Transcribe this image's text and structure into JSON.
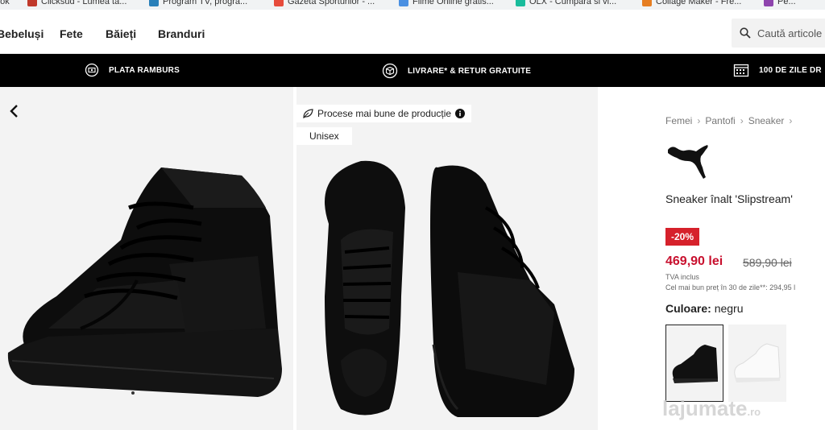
{
  "bookmarks": [
    {
      "label": "ook",
      "color": "#3b5998"
    },
    {
      "label": "Clicksud - Lumea ta...",
      "color": "#c0392b"
    },
    {
      "label": "Program TV, progra...",
      "color": "#2980b9"
    },
    {
      "label": "Gazeta Sporturilor - ...",
      "color": "#e74c3c"
    },
    {
      "label": "Filme Online gratis...",
      "color": "#4a90e2"
    },
    {
      "label": "OLX - Cumpara si vi...",
      "color": "#1abc9c"
    },
    {
      "label": "Collage Maker - Fre...",
      "color": "#e67e22"
    },
    {
      "label": "Pe...",
      "color": "#8e44ad"
    }
  ],
  "nav": {
    "categories": [
      "Bebeluși",
      "Fete",
      "Băieți",
      "Branduri"
    ],
    "search_placeholder": "Caută articole"
  },
  "promo": {
    "items": [
      {
        "label": "PLATA RAMBURS",
        "icon": "cash-icon"
      },
      {
        "label": "LIVRARE* & RETUR GRATUITE",
        "icon": "box-icon"
      },
      {
        "label": "100 DE ZILE DR",
        "icon": "calendar-icon"
      }
    ]
  },
  "gallery": {
    "badge_sustainable": "Procese mai bune de producție",
    "badge_gender": "Unisex"
  },
  "product": {
    "breadcrumb": [
      "Femei",
      "Pantofi",
      "Sneaker"
    ],
    "brand": "PUMA",
    "name": "Sneaker înalt 'Slipstream'",
    "discount": "-20%",
    "price": "469,90 lei",
    "old_price": "589,90 lei",
    "vat": "TVA inclus",
    "best_price": "Cel mai bun preț în 30 de zile**: 294,95 l",
    "color_label": "Culoare:",
    "color_value": "negru",
    "swatches": [
      "negru",
      "alb"
    ]
  },
  "watermark": {
    "text": "lajumate",
    "suffix": ".ro"
  },
  "colors": {
    "accent": "#c8102e",
    "badge_red": "#d6212b",
    "promo_bar": "#000000"
  }
}
